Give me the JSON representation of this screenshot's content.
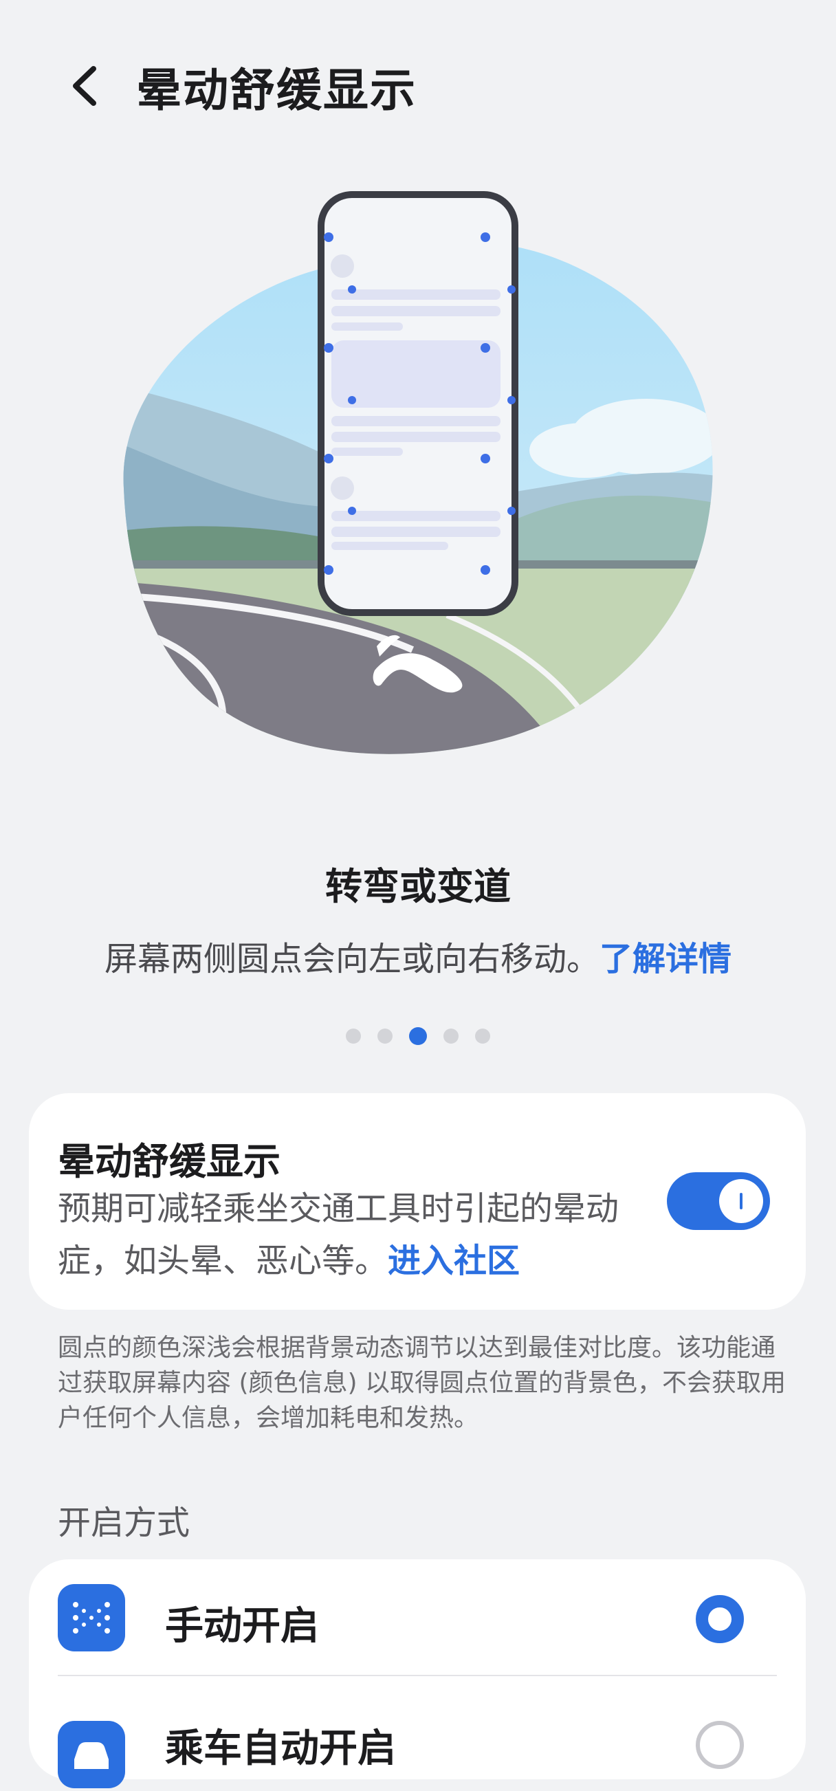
{
  "header": {
    "title": "晕动舒缓显示"
  },
  "carousel": {
    "title": "转弯或变道",
    "description": "屏幕两侧圆点会向左或向右移动。",
    "link": "了解详情",
    "page_count": 5,
    "active_page": 3
  },
  "main_setting": {
    "title": "晕动舒缓显示",
    "description": "预期可减轻乘坐交通工具时引起的晕动症，如头晕、恶心等。",
    "link": "进入社区",
    "enabled": true
  },
  "note": "圆点的颜色深浅会根据背景动态调节以达到最佳对比度。该功能通过获取屏幕内容 (颜色信息) 以取得圆点位置的背景色，不会获取用户任何个人信息，会增加耗电和发热。",
  "modes": {
    "section_label": "开启方式",
    "items": [
      {
        "label": "手动开启",
        "icon": "dots-grid-icon",
        "selected": true
      },
      {
        "label": "乘车自动开启",
        "icon": "car-icon",
        "selected": false
      }
    ]
  },
  "colors": {
    "accent": "#2b6fe0",
    "background": "#f1f2f4"
  }
}
